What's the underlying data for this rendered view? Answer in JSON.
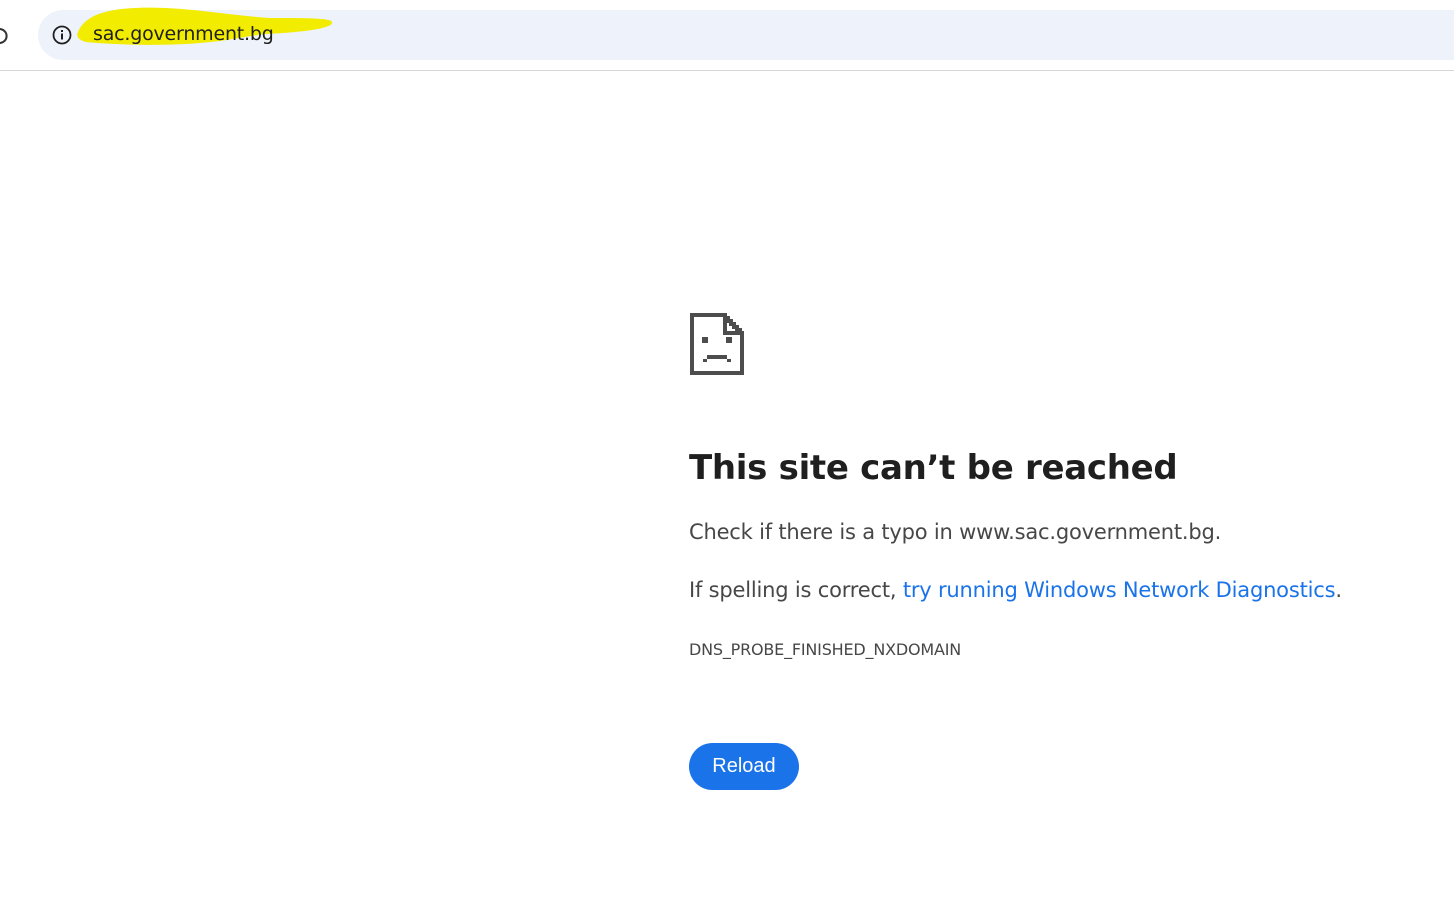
{
  "browser": {
    "address_bar": {
      "url": "sac.government.bg",
      "info_icon": "info-circle-icon",
      "highlight_color": "#f2ec00"
    },
    "nav": {
      "reload_icon": "reload-icon"
    }
  },
  "error_page": {
    "icon": "sad-document-icon",
    "title": "This site can’t be reached",
    "typo_message": "Check if there is a typo in www.sac.government.bg.",
    "spelling_prefix": "If spelling is correct, ",
    "diagnostics_link": "try running Windows Network Diagnostics",
    "spelling_suffix": ".",
    "error_code": "DNS_PROBE_FINISHED_NXDOMAIN",
    "reload_label": "Reload",
    "colors": {
      "link": "#1a73e8",
      "button": "#1a73e8",
      "text": "#474747",
      "title": "#1f1f1f"
    }
  }
}
